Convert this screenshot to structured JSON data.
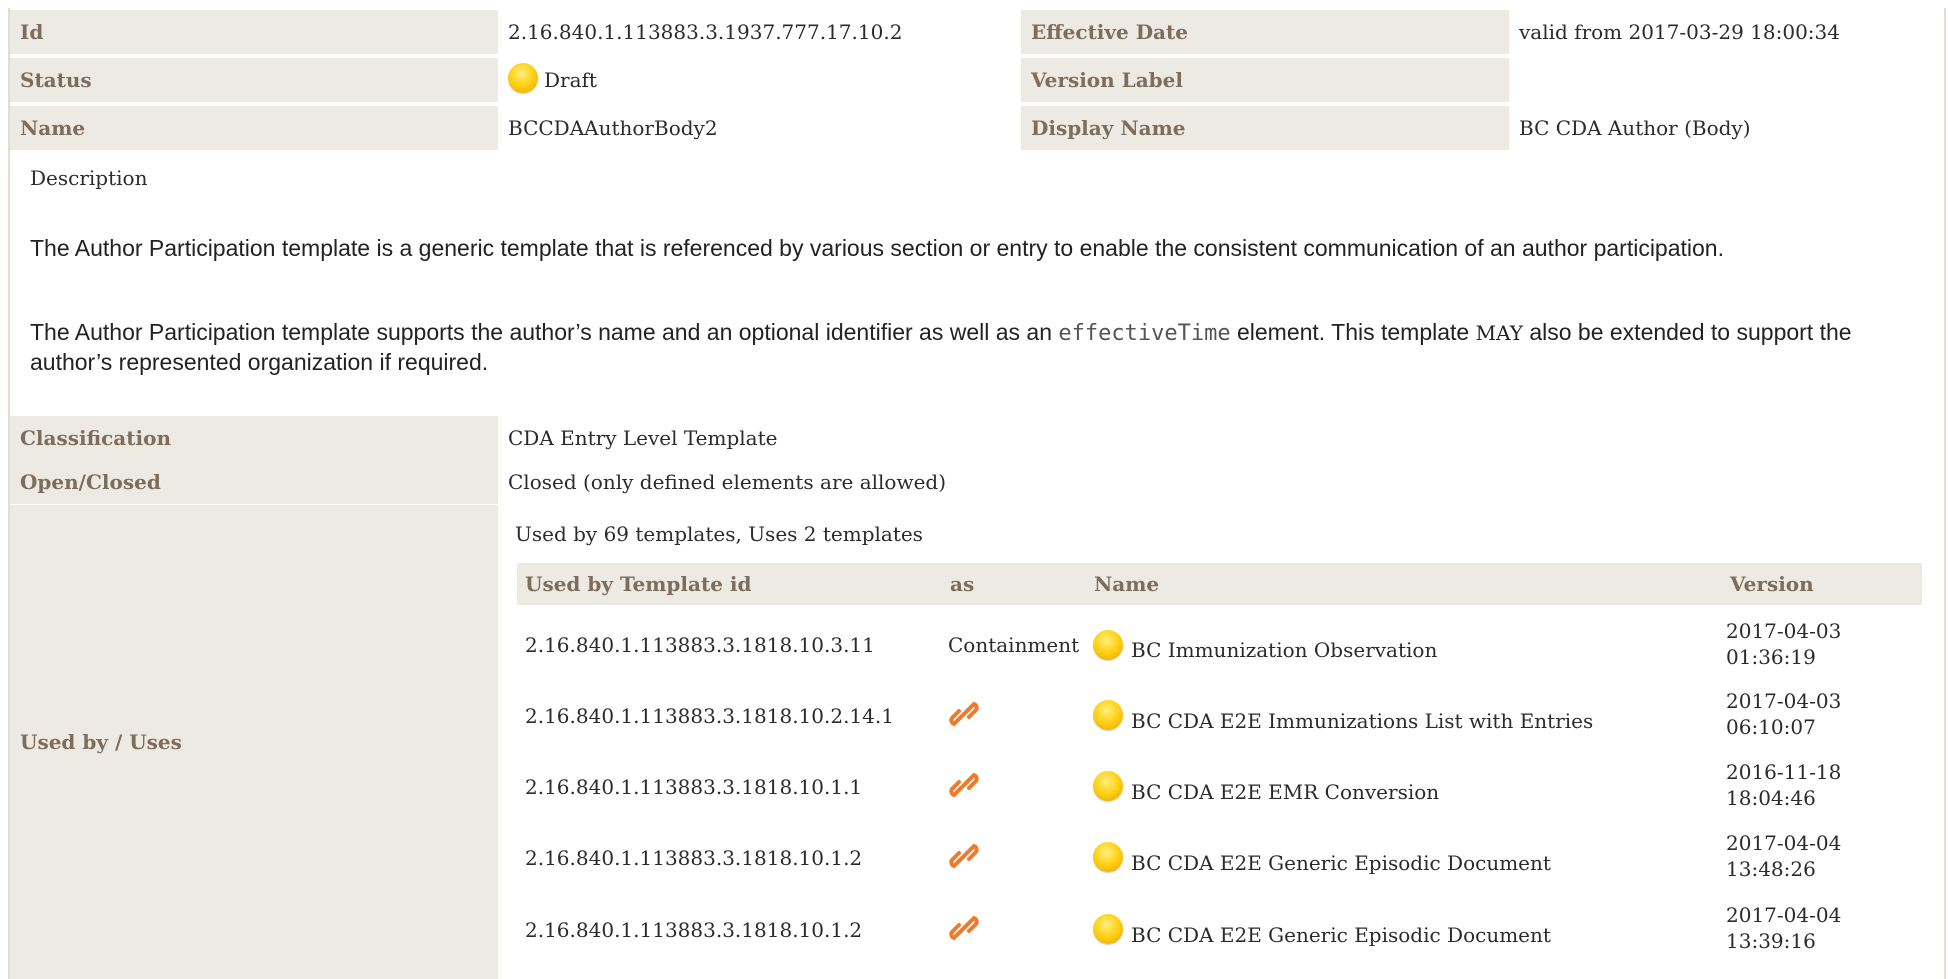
{
  "header": {
    "id_label": "Id",
    "id_value": "2.16.840.1.113883.3.1937.777.17.10.2",
    "effective_label": "Effective Date",
    "effective_value": "valid from 2017-03-29 18:00:34",
    "status_label": "Status",
    "status_value": "Draft",
    "version_label": "Version Label",
    "version_value": "",
    "name_label": "Name",
    "name_value": "BCCDAAuthorBody2",
    "display_label": "Display Name",
    "display_value": "BC CDA Author (Body)"
  },
  "description": {
    "heading": "Description",
    "p1": "The Author Participation template is a generic template that is referenced by various section or entry to enable the consistent communication of an author participation.",
    "p2_before": "The Author Participation template supports the author’s name and an optional identifier as well as an ",
    "p2_code": "effectiveTime",
    "p2_middle": " element. This template ",
    "p2_keyword": "MAY",
    "p2_after": " also be extended to support the author’s represented organization if required."
  },
  "properties": {
    "classification_label": "Classification",
    "classification_value": "CDA Entry Level Template",
    "openclosed_label": "Open/Closed",
    "openclosed_value": "Closed (only defined elements are allowed)",
    "usedby_label": "Used by / Uses"
  },
  "usage": {
    "summary": "Used by 69 templates, Uses 2 templates",
    "columns": [
      "Used by Template id",
      "as",
      "Name",
      "Version"
    ],
    "rows": [
      {
        "id": "2.16.840.1.113883.3.1818.10.3.11",
        "as": "Containment",
        "as_icon": "",
        "status_icon": "status-draft-icon",
        "name": "BC Immunization Observation",
        "version_date": "2017-04-03",
        "version_time": "01:36:19"
      },
      {
        "id": "2.16.840.1.113883.3.1818.10.2.14.1",
        "as": "",
        "as_icon": "link-icon",
        "status_icon": "status-draft-icon",
        "name": "BC CDA E2E Immunizations List with Entries",
        "version_date": "2017-04-03",
        "version_time": "06:10:07"
      },
      {
        "id": "2.16.840.1.113883.3.1818.10.1.1",
        "as": "",
        "as_icon": "link-icon",
        "status_icon": "status-draft-icon",
        "name": "BC CDA E2E EMR Conversion",
        "version_date": "2016-11-18",
        "version_time": "18:04:46"
      },
      {
        "id": "2.16.840.1.113883.3.1818.10.1.2",
        "as": "",
        "as_icon": "link-icon",
        "status_icon": "status-draft-icon",
        "name": "BC CDA E2E Generic Episodic Document",
        "version_date": "2017-04-04",
        "version_time": "13:48:26"
      },
      {
        "id": "2.16.840.1.113883.3.1818.10.1.2",
        "as": "",
        "as_icon": "link-icon",
        "status_icon": "status-draft-icon",
        "name": "BC CDA E2E Generic Episodic Document",
        "version_date": "2017-04-04",
        "version_time": "13:39:16"
      }
    ]
  },
  "colors": {
    "label_bg": "#ede9e3",
    "label_text": "#7d6d5c",
    "draft_status": "#ffd21a",
    "link_icon": "#f07a2a"
  }
}
